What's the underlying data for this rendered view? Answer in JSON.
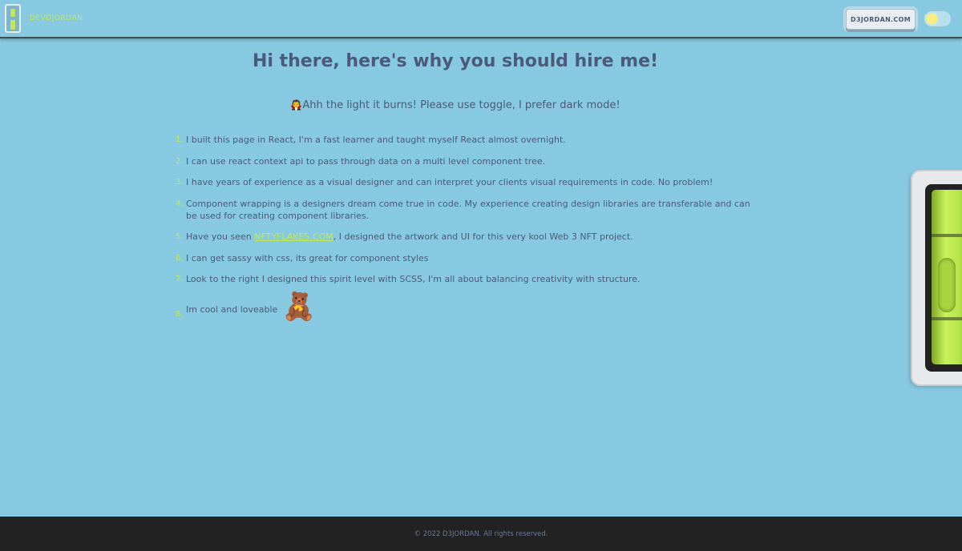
{
  "header": {
    "brand": "DEVDJORDAN",
    "site_button": "D3JORDAN.COM",
    "theme_toggle": "light"
  },
  "main": {
    "title": "Hi there, here's why you should hire me!",
    "subtitle_emoji": "🧛",
    "subtitle": "Ahh the light it burns! Please use toggle, I prefer dark mode!",
    "reasons": [
      {
        "num": "1.",
        "text": "I built this page in React, I'm a fast learner and taught myself React almost overnight."
      },
      {
        "num": "2.",
        "text": "I can use react context api to pass through data on a multi level component tree."
      },
      {
        "num": "3.",
        "text": "I have years of experience as a visual designer and can interpret your clients visual requirements in code. No problem!"
      },
      {
        "num": "4.",
        "text": "Component wrapping is a designers dream come true in code. My experience creating design libraries are transferable and can be used for creating component libraries."
      },
      {
        "num": "5.",
        "before": "Have you seen ",
        "link": "NFTYFLAKES.COM",
        "after": ", I designed the artwork and UI for this very kool Web 3 NFT project."
      },
      {
        "num": "6.",
        "text": "I can get sassy with css, its great for component styles"
      },
      {
        "num": "7.",
        "text": "Look to the right I designed this spirit level with SCSS, I'm all about balancing creativity with structure."
      },
      {
        "num": "8.",
        "text": "Im cool and loveable",
        "emoji": "🧸"
      }
    ]
  },
  "footer": {
    "copyright": "© 2022 D3JORDAN. All rights reserved."
  },
  "colors": {
    "background": "#87c9e1",
    "accent": "#bfe95a",
    "text": "#4a5a78",
    "footer": "#222222"
  },
  "icons": {
    "logo": "spirit-level-logo-icon",
    "toggle_knob": "sun-icon"
  }
}
